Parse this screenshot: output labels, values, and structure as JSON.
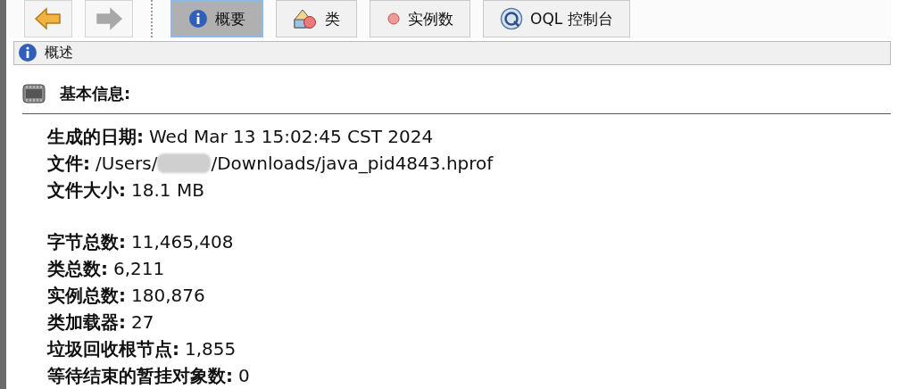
{
  "toolbar": {
    "nav_buttons": [
      {
        "kind": "back",
        "disabled": false
      },
      {
        "kind": "forward",
        "disabled": true
      }
    ],
    "tabs": [
      {
        "kind": "info",
        "label": "概要",
        "selected": true
      },
      {
        "kind": "classes",
        "label": "类",
        "selected": false
      },
      {
        "kind": "instances",
        "label": "实例数",
        "selected": false
      },
      {
        "kind": "query",
        "label": "OQL 控制台",
        "selected": false
      }
    ]
  },
  "header": {
    "title": "概述"
  },
  "section": {
    "title": "基本信息:",
    "groups": [
      [
        {
          "label": "生成的日期:",
          "value": "Wed Mar 13 15:02:45 CST 2024"
        },
        {
          "label": "文件:",
          "value": "/Users/",
          "redacted": true,
          "value_after": "/Downloads/java_pid4843.hprof"
        },
        {
          "label": "文件大小:",
          "value": "18.1 MB"
        }
      ],
      [
        {
          "label": "字节总数:",
          "value": "11,465,408"
        },
        {
          "label": "类总数:",
          "value": "6,211"
        },
        {
          "label": "实例总数:",
          "value": "180,876"
        },
        {
          "label": "类加载器:",
          "value": "27"
        },
        {
          "label": "垃圾回收根节点:",
          "value": "1,855"
        },
        {
          "label": "等待结束的暂挂对象数:",
          "value": "0"
        }
      ]
    ]
  }
}
